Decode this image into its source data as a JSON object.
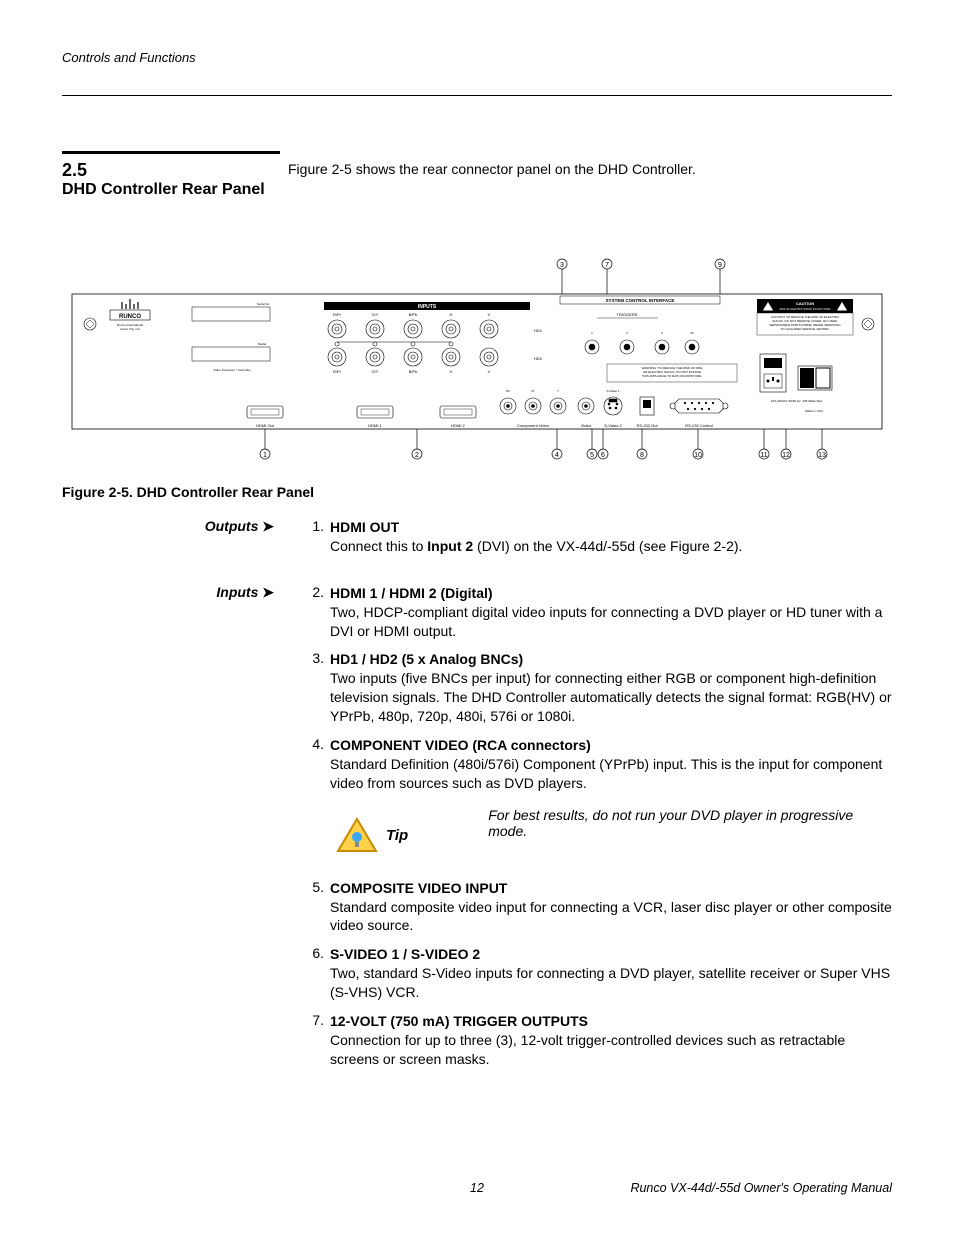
{
  "header": {
    "section_path": "Controls and Functions"
  },
  "section": {
    "number": "2.5",
    "title": "DHD Controller Rear Panel",
    "intro": "Figure 2-5 shows the rear connector panel on the DHD Controller."
  },
  "figure": {
    "caption": "Figure 2-5. DHD Controller Rear Panel",
    "top_callouts": [
      "3",
      "7",
      "9"
    ],
    "bottom_callouts": [
      "1",
      "2",
      "4",
      "5",
      "6",
      "8",
      "10",
      "11",
      "12",
      "13"
    ],
    "panel": {
      "brand_top": "RUNCO",
      "brand_sub1": "Runco International",
      "brand_sub2": "Union City, CA",
      "serial_label": "Serial No.",
      "model_label": "Model",
      "proc_label": "Video Processor / Controller",
      "inputs_label": "INPUTS",
      "hd_cols": [
        "R/Pr",
        "G/Y",
        "B/Pb",
        "H",
        "V"
      ],
      "hd1": "HD1",
      "hd2": "HD2",
      "sci_label": "SYSTEM CONTROL INTERFACE",
      "triggers_label": "TRIGGERS",
      "trigger_nums": [
        "1",
        "2",
        "3"
      ],
      "ir_label": "IR",
      "caution_title": "CAUTION",
      "caution_sub": "RISK OF ELECTRIC SHOCK DO NOT OPEN",
      "caution_body": "CAUTION: TO REDUCE THE RISK OF ELECTRIC SHOCK, DO NOT REMOVE COVER. NO USER-SERVICEABLE PARTS INSIDE. REFER SERVICING TO QUALIFIED SERVICE CENTER.",
      "warning_body": "WARNING: TO REDUCE THE RISK OF FIRE OR ELECTRIC SHOCK, DO NOT EXPOSE THIS APPLIANCE TO RAIN OR MOISTURE.",
      "power_label": "100-230VAC 50/60 Hz, 195 Watts Max.",
      "made_label": "Made in USA",
      "bottom_row": {
        "hdmi_out": "HDMI Out",
        "hdmi1": "HDMI 1",
        "hdmi2": "HDMI 2",
        "comp_cols": [
          "Pb",
          "Pr",
          "Y"
        ],
        "comp_label": "Component Video",
        "video": "Video",
        "sv1": "S-Video 1",
        "sv2": "S-Video 2",
        "rs232_out": "RS-232 Out",
        "rs232_ctrl": "RS-232 Control"
      }
    }
  },
  "outputs_label": "Outputs",
  "inputs_label": "Inputs",
  "items": [
    {
      "n": "1.",
      "title": "HDMI OUT",
      "desc": "Connect this to Input 2 (DVI) on the VX-44d/-55d (see Figure 2-2).",
      "bold_inline": "Input 2"
    },
    {
      "n": "2.",
      "title": "HDMI 1 / HDMI 2 (Digital)",
      "desc": "Two, HDCP-compliant digital video inputs for connecting a DVD player or HD tuner with a DVI or HDMI output."
    },
    {
      "n": "3.",
      "title": "HD1 / HD2 (5 x Analog BNCs)",
      "desc": "Two inputs (five BNCs per input) for connecting either RGB or component high-definition television signals. The DHD Controller automatically detects the signal format: RGB(HV) or YPrPb, 480p, 720p, 480i, 576i or 1080i."
    },
    {
      "n": "4.",
      "title": "COMPONENT VIDEO (RCA connectors)",
      "desc": "Standard Definition (480i/576i) Component (YPrPb) input. This is the input for component video from sources such as DVD players."
    },
    {
      "n": "5.",
      "title": "COMPOSITE VIDEO INPUT",
      "desc": "Standard composite video input for connecting a VCR, laser disc player or other composite video source."
    },
    {
      "n": "6.",
      "title": "S-VIDEO 1 / S-VIDEO 2",
      "desc": "Two, standard S-Video inputs for connecting a DVD player, satellite receiver or Super VHS (S-VHS) VCR."
    },
    {
      "n": "7.",
      "title": "12-VOLT (750 mA) TRIGGER OUTPUTS",
      "desc": "Connection for up to three (3), 12-volt trigger-controlled devices such as retractable screens or screen masks."
    }
  ],
  "tip": {
    "label": "Tip",
    "text": "For best results, do not run your DVD player in progressive mode."
  },
  "footer": {
    "page": "12",
    "doc": "Runco VX-44d/-55d Owner's Operating Manual"
  }
}
